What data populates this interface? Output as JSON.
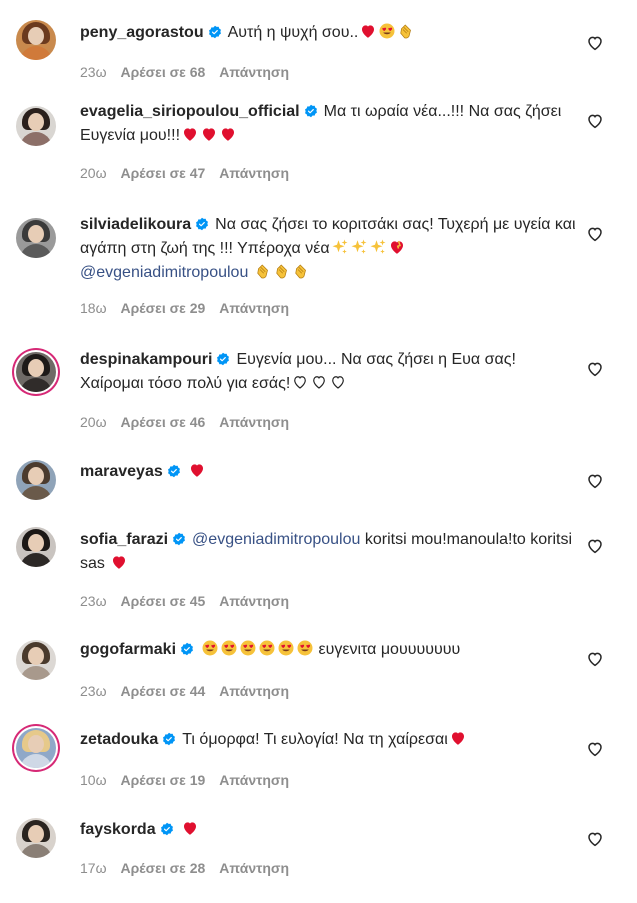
{
  "comments": [
    {
      "user": "peny_agorastou",
      "text": "Αυτή η ψυχή σου..",
      "emoji": [
        "red-heart",
        "heart-eyes",
        "clapping"
      ],
      "time": "23ω",
      "likes": "Αρέσει σε 68",
      "reply": "Απάντηση",
      "ring": false,
      "avatar_colors": {
        "bg": "#c98a4d",
        "hair": "#6b3a1e",
        "shoulders": "#d07a3a"
      }
    },
    {
      "user": "evagelia_siriopoulou_official",
      "text": "Μα τι ωραία νέα...!!! Να σας ζήσει Ευγενία μου!!!",
      "emoji": [
        "red-heart",
        "red-heart",
        "red-heart"
      ],
      "time": "20ω",
      "likes": "Αρέσει σε 47",
      "reply": "Απάντηση",
      "ring": false,
      "avatar_colors": {
        "bg": "#d9d6d2",
        "hair": "#2a201c",
        "shoulders": "#8c6f68"
      }
    },
    {
      "user": "silviadelikoura",
      "text": "Να σας ζήσει το κοριτσάκι σας! Τυχερή με υγεία και αγάπη στη ζωή της !!! Υπέροχα νέα",
      "emoji": [
        "sparkles",
        "sparkles",
        "sparkles",
        "heart-ribbon"
      ],
      "mention": "@evgeniadimitropoulou",
      "emoji2": [
        "clapping",
        "clapping",
        "clapping"
      ],
      "time": "18ω",
      "likes": "Αρέσει σε 29",
      "reply": "Απάντηση",
      "ring": false,
      "avatar_colors": {
        "bg": "#9a9a9a",
        "hair": "#3a3a3a",
        "shoulders": "#5a5a5a"
      }
    },
    {
      "user": "despinakampouri",
      "text": "Ευγενία μου... Να σας ζήσει η Ευα σας! Χαίρομαι τόσο πολύ για εσάς!",
      "emoji": [
        "white-heart",
        "white-heart",
        "white-heart"
      ],
      "time": "20ω",
      "likes": "Αρέσει σε 46",
      "reply": "Απάντηση",
      "ring": true,
      "avatar_colors": {
        "bg": "#6f6a66",
        "hair": "#1e1a18",
        "shoulders": "#302c2a"
      }
    },
    {
      "user": "maraveyas",
      "text": "",
      "emoji": [
        "red-heart"
      ],
      "time": "",
      "likes": "",
      "reply": "",
      "ring": false,
      "avatar_colors": {
        "bg": "#8fa3b8",
        "hair": "#4b3b2e",
        "shoulders": "#6a5a4a"
      }
    },
    {
      "user": "sofia_farazi",
      "text": "",
      "mention": "@evgeniadimitropoulou",
      "text_after": "koritsi mou!manoula!to koritsi sas",
      "emoji": [
        "red-heart"
      ],
      "time": "23ω",
      "likes": "Αρέσει σε 45",
      "reply": "Απάντηση",
      "ring": false,
      "avatar_colors": {
        "bg": "#c9c4c0",
        "hair": "#1c1816",
        "shoulders": "#2c2826"
      }
    },
    {
      "user": "gogofarmaki",
      "text": "",
      "emoji": [
        "heart-eyes",
        "heart-eyes",
        "heart-eyes",
        "heart-eyes",
        "heart-eyes",
        "heart-eyes"
      ],
      "text_after": "ευγενιτα μουυυυυυυ",
      "time": "23ω",
      "likes": "Αρέσει σε 44",
      "reply": "Απάντηση",
      "ring": false,
      "avatar_colors": {
        "bg": "#dcd8d4",
        "hair": "#4a3a2c",
        "shoulders": "#a8998c"
      }
    },
    {
      "user": "zetadouka",
      "text": "Τι όμορφα! Τι ευλογία! Να τη χαίρεσαι",
      "emoji": [
        "red-heart"
      ],
      "time": "10ω",
      "likes": "Αρέσει σε 19",
      "reply": "Απάντηση",
      "ring": true,
      "avatar_colors": {
        "bg": "#8fa8c8",
        "hair": "#e6c98a",
        "shoulders": "#cfd8e6"
      }
    },
    {
      "user": "fayskorda",
      "text": "",
      "emoji": [
        "red-heart"
      ],
      "time": "17ω",
      "likes": "Αρέσει σε 28",
      "reply": "Απάντηση",
      "ring": false,
      "avatar_colors": {
        "bg": "#d8d2cc",
        "hair": "#2a2420",
        "shoulders": "#8a7f76"
      }
    }
  ],
  "icons": {
    "verified": "verified-badge-icon",
    "like": "heart-outline-icon"
  },
  "colors": {
    "verified": "#0095f6",
    "heart": "#ed4956",
    "mention": "#385185",
    "meta": "#8e8e8e"
  }
}
